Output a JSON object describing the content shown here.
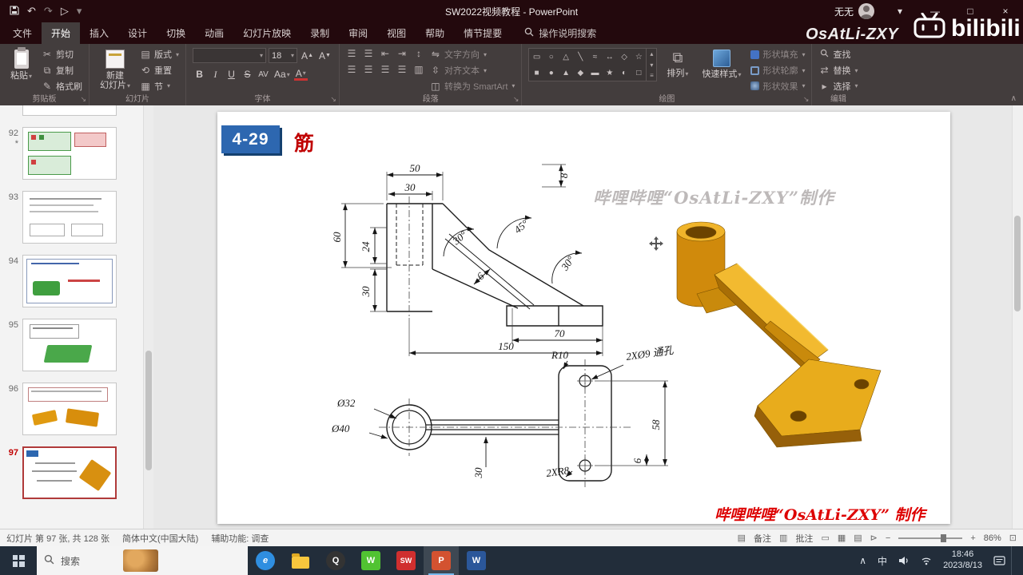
{
  "titlebar": {
    "title": "SW2022视频教程 - PowerPoint",
    "user_name": "无无",
    "win": {
      "min": "―",
      "max": "□",
      "close": "×"
    }
  },
  "icons": {
    "caret": "▾",
    "launcher": "↘",
    "chevron_up": "∧",
    "undo": "↶",
    "redo": "↷",
    "play": "▷",
    "menu_more": "▾",
    "cut": "✂",
    "copy": "⧉",
    "painter": "✎",
    "replace": "⇄",
    "select": "▸",
    "shape_glyphs1": [
      "▭",
      "○",
      "△",
      "╲",
      "≈",
      "↔",
      "◇",
      "☆"
    ],
    "shape_glyphs2": [
      "■",
      "●",
      "▲",
      "◆",
      "▬",
      "★",
      "◐",
      "□"
    ],
    "para_glyphs1": [
      "☰",
      "☰",
      "⇤",
      "⇥",
      "↕"
    ],
    "para_glyphs2": [
      "☰",
      "☰",
      "☰",
      "☰",
      "▥"
    ]
  },
  "overlay": {
    "watermark": "OsAtLi-ZXY",
    "logo_text": "bilibili"
  },
  "tabs": [
    {
      "label": "文件"
    },
    {
      "label": "开始"
    },
    {
      "label": "插入"
    },
    {
      "label": "设计"
    },
    {
      "label": "切换"
    },
    {
      "label": "动画"
    },
    {
      "label": "幻灯片放映"
    },
    {
      "label": "录制"
    },
    {
      "label": "审阅"
    },
    {
      "label": "视图"
    },
    {
      "label": "帮助"
    },
    {
      "label": "情节提要"
    }
  ],
  "tell_me": "操作说明搜索",
  "ribbon": {
    "clipboard": {
      "group": "剪贴板",
      "paste": "粘贴",
      "cut": "剪切",
      "copy": "复制",
      "painter": "格式刷"
    },
    "slides": {
      "group": "幻灯片",
      "new_slide_1": "新建",
      "new_slide_2": "幻灯片",
      "layout": "版式",
      "reset": "重置",
      "section": "节"
    },
    "font": {
      "group": "字体",
      "size": "18",
      "bold": "B",
      "italic": "I",
      "underline": "U",
      "strike": "S",
      "spacing": "AV",
      "case_btn": "Aa",
      "color": "A",
      "grow": "A",
      "shrink": "A"
    },
    "paragraph": {
      "group": "段落",
      "direction": "文字方向",
      "align_text": "对齐文本",
      "smartart": "转换为 SmartArt"
    },
    "drawing": {
      "group": "绘图",
      "arrange": "排列",
      "styles": "快速样式",
      "fill": "形状填充",
      "outline": "形状轮廓",
      "effects": "形状效果"
    },
    "editing": {
      "group": "编辑",
      "find": "查找",
      "replace": "替换",
      "select": "选择"
    }
  },
  "panel": {
    "thumbs": [
      {
        "num": "92",
        "mark": "*"
      },
      {
        "num": "93",
        "mark": ""
      },
      {
        "num": "94",
        "mark": ""
      },
      {
        "num": "95",
        "mark": ""
      },
      {
        "num": "96",
        "mark": ""
      },
      {
        "num": "97",
        "mark": ""
      }
    ]
  },
  "slide": {
    "badge": "4-29",
    "heading": "筋",
    "watermark_top": "哔哩哔哩“OsAtLi-ZXY”制作",
    "watermark_bottom": "哔哩哔哩“OsAtLi-ZXY” 制作"
  },
  "drawing_dims": {
    "w50": "50",
    "w30": "30",
    "h8": "8",
    "h60": "60",
    "h24": "24",
    "h30": "30",
    "a30a": "30°",
    "a45": "45°",
    "a30b": "30°",
    "t6": "6",
    "len150": "150",
    "len70": "70",
    "r10": "R10",
    "holes": "2XØ9 通孔",
    "dia32": "Ø32",
    "dia40": "Ø40",
    "b30": "30",
    "r8": "2XR8",
    "b6": "6",
    "b58": "58"
  },
  "status": {
    "slide_info": "幻灯片 第 97 张, 共 128 张",
    "language": "简体中文(中国大陆)",
    "accessibility": "辅助功能: 调查",
    "notes": "备注",
    "comments": "批注",
    "zoom": "86%",
    "icons": {
      "notes_icon": "▤",
      "comments_icon": "▥",
      "views": [
        "▭",
        "▦",
        "▤",
        "⊳"
      ],
      "fit": "⊡",
      "minus": "−",
      "plus": "+"
    }
  },
  "taskbar": {
    "search_placeholder": "搜索",
    "time": "18:46",
    "date": "2023/8/13",
    "ime": "中",
    "tray_expand": "∧",
    "apps": [
      {
        "name": "edge",
        "glyph": "e"
      },
      {
        "name": "file-explorer",
        "glyph": ""
      },
      {
        "name": "qq",
        "glyph": "Q"
      },
      {
        "name": "wechat",
        "glyph": "W"
      },
      {
        "name": "solidworks",
        "glyph": "SW"
      },
      {
        "name": "powerpoint",
        "glyph": "P"
      },
      {
        "name": "word",
        "glyph": "W"
      }
    ]
  }
}
